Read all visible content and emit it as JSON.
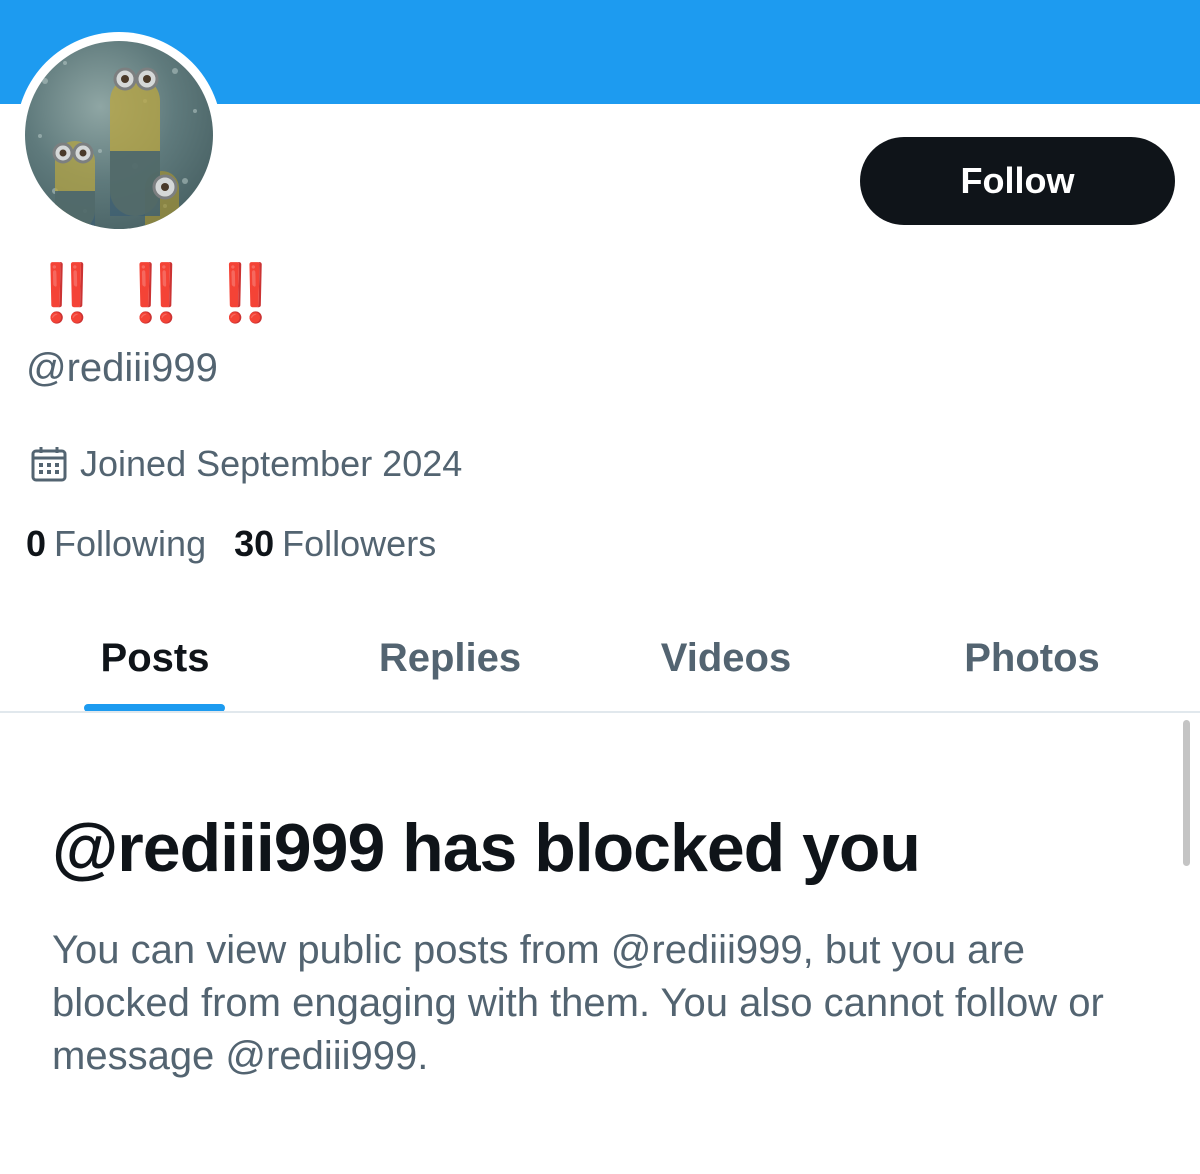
{
  "profile": {
    "display_name": "‼️ ‼️ ‼️",
    "handle": "@rediii999",
    "joined": "Joined September 2024",
    "avatar_icon": "minions-avatar"
  },
  "actions": {
    "follow_label": "Follow"
  },
  "stats": {
    "following_count": "0",
    "following_label": "Following",
    "followers_count": "30",
    "followers_label": "Followers"
  },
  "tabs": [
    {
      "label": "Posts",
      "active": true
    },
    {
      "label": "Replies",
      "active": false
    },
    {
      "label": "Videos",
      "active": false
    },
    {
      "label": "Photos",
      "active": false
    }
  ],
  "blocked": {
    "title": "@rediii999 has blocked you",
    "description": "You can view public posts from @rediii999, but you are blocked from engaging with them. You also cannot follow or message @rediii999."
  },
  "colors": {
    "accent": "#1d9bf0",
    "text_primary": "#0f1419",
    "text_secondary": "#536471",
    "display_name": "#e0241b"
  },
  "icons": {
    "joined": "calendar-icon"
  }
}
